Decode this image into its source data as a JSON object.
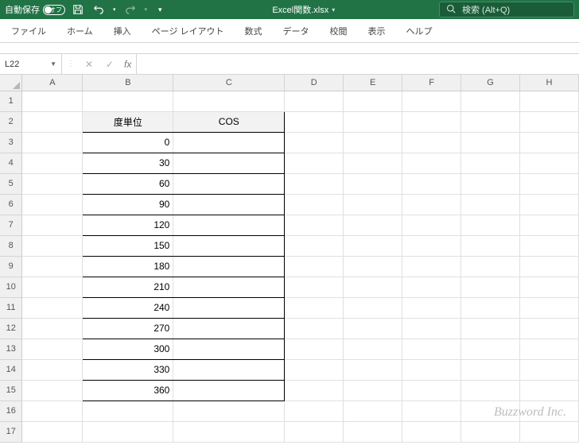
{
  "titlebar": {
    "autosave_label": "自動保存",
    "autosave_state": "オフ",
    "filename": "Excel関数.xlsx",
    "search_placeholder": "検索 (Alt+Q)"
  },
  "ribbon": {
    "tabs": [
      "ファイル",
      "ホーム",
      "挿入",
      "ページ レイアウト",
      "数式",
      "データ",
      "校閲",
      "表示",
      "ヘルプ"
    ]
  },
  "formula_bar": {
    "name_box": "L22",
    "formula": ""
  },
  "columns": [
    "A",
    "B",
    "C",
    "D",
    "E",
    "F",
    "G",
    "H"
  ],
  "row_count": 17,
  "sheet": {
    "headers": {
      "B": "度単位",
      "C": "COS"
    },
    "data_rows": [
      {
        "B": "0",
        "C": ""
      },
      {
        "B": "30",
        "C": ""
      },
      {
        "B": "60",
        "C": ""
      },
      {
        "B": "90",
        "C": ""
      },
      {
        "B": "120",
        "C": ""
      },
      {
        "B": "150",
        "C": ""
      },
      {
        "B": "180",
        "C": ""
      },
      {
        "B": "210",
        "C": ""
      },
      {
        "B": "240",
        "C": ""
      },
      {
        "B": "270",
        "C": ""
      },
      {
        "B": "300",
        "C": ""
      },
      {
        "B": "330",
        "C": ""
      },
      {
        "B": "360",
        "C": ""
      }
    ]
  },
  "watermark": "Buzzword Inc."
}
